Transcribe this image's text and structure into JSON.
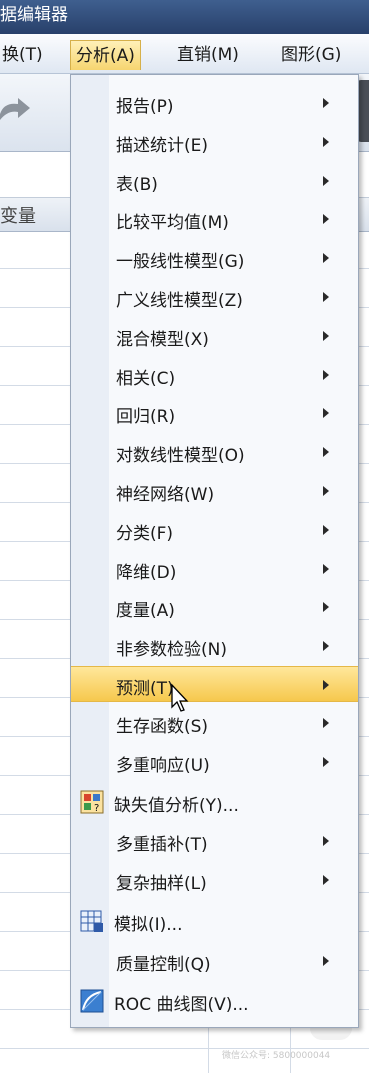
{
  "window": {
    "title": "据编辑器"
  },
  "menubar": {
    "items": [
      {
        "label": "换(T)"
      },
      {
        "label": "分析(A)"
      },
      {
        "label": "直销(M)"
      },
      {
        "label": "图形(G)"
      }
    ]
  },
  "grid": {
    "column_header": "变量"
  },
  "analyze_menu": {
    "items": [
      {
        "label": "报告(P)",
        "submenu": true
      },
      {
        "label": "描述统计(E)",
        "submenu": true
      },
      {
        "label": "表(B)",
        "submenu": true
      },
      {
        "label": "比较平均值(M)",
        "submenu": true
      },
      {
        "label": "一般线性模型(G)",
        "submenu": true
      },
      {
        "label": "广义线性模型(Z)",
        "submenu": true
      },
      {
        "label": "混合模型(X)",
        "submenu": true
      },
      {
        "label": "相关(C)",
        "submenu": true
      },
      {
        "label": "回归(R)",
        "submenu": true
      },
      {
        "label": "对数线性模型(O)",
        "submenu": true
      },
      {
        "label": "神经网络(W)",
        "submenu": true
      },
      {
        "label": "分类(F)",
        "submenu": true
      },
      {
        "label": "降维(D)",
        "submenu": true
      },
      {
        "label": "度量(A)",
        "submenu": true
      },
      {
        "label": "非参数检验(N)",
        "submenu": true
      },
      {
        "label": "预测(T)",
        "submenu": true,
        "highlighted": true
      },
      {
        "label": "生存函数(S)",
        "submenu": true
      },
      {
        "label": "多重响应(U)",
        "submenu": true
      },
      {
        "label": "缺失值分析(Y)...",
        "icon": "missing-value-analysis-icon"
      },
      {
        "label": "多重插补(T)",
        "submenu": true
      },
      {
        "label": "复杂抽样(L)",
        "submenu": true
      },
      {
        "label": "模拟(I)...",
        "icon": "simulation-icon"
      },
      {
        "label": "质量控制(Q)",
        "submenu": true
      },
      {
        "label": "ROC 曲线图(V)...",
        "icon": "roc-curve-icon"
      }
    ]
  },
  "watermark": {
    "text": "微信公众号: 5800000044"
  }
}
